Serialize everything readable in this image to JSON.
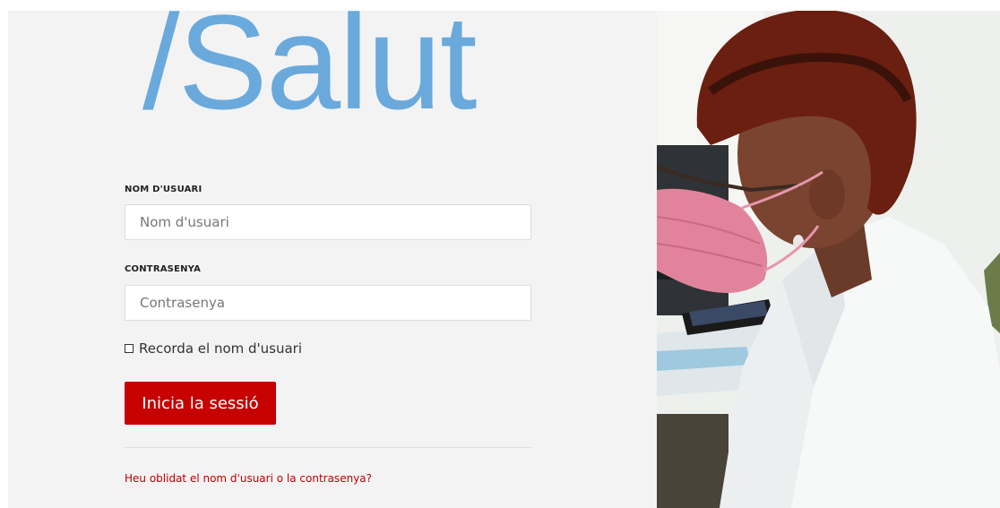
{
  "brand": {
    "logo_text": "/Salut"
  },
  "login_form": {
    "username_label": "NOM D'USUARI",
    "username_placeholder": "Nom d'usuari",
    "password_label": "CONTRASENYA",
    "password_placeholder": "Contrasenya",
    "remember_label": "Recorda el nom d'usuari",
    "remember_checked": false,
    "submit_label": "Inicia la sessió",
    "forgot_link": "Heu oblidat el nom d'usuari o la contrasenya?"
  },
  "colors": {
    "logo_blue": "#6aa9dc",
    "button_red": "#c70000",
    "link_red": "#c00000",
    "panel_bg": "#f3f3f4"
  }
}
